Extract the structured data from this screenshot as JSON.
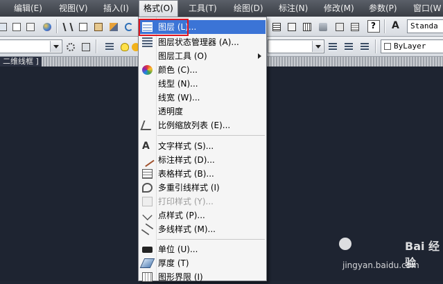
{
  "menubar": {
    "items": [
      "编辑(E)",
      "视图(V)",
      "插入(I)",
      "格式(O)",
      "工具(T)",
      "绘图(D)",
      "标注(N)",
      "修改(M)",
      "参数(P)",
      "窗口(W"
    ],
    "active_index": 3
  },
  "toolbar": {
    "style_combo_value": "Standa",
    "bylayer_combo_value": "ByLayer"
  },
  "viewport": {
    "label": "二维线框 ]"
  },
  "format_menu": {
    "items": [
      {
        "label": "图层 (L)...",
        "icon": "layer-icon",
        "selected": true
      },
      {
        "label": "图层状态管理器 (A)...",
        "icon": "layer-state-manager-icon"
      },
      {
        "label": "图层工具 (O)",
        "icon": "",
        "submenu": true
      },
      {
        "label": "颜色 (C)...",
        "icon": "color-wheel-icon"
      },
      {
        "label": "线型 (N)...",
        "icon": ""
      },
      {
        "label": "线宽 (W)...",
        "icon": ""
      },
      {
        "label": "透明度",
        "icon": ""
      },
      {
        "label": "比例缩放列表 (E)...",
        "icon": "scale-list-icon"
      },
      {
        "label": "文字样式 (S)...",
        "icon": "text-style-icon"
      },
      {
        "label": "标注样式 (D)...",
        "icon": "dimension-style-icon"
      },
      {
        "label": "表格样式 (B)...",
        "icon": "table-style-icon"
      },
      {
        "label": "多重引线样式 (I)",
        "icon": "multileader-style-icon"
      },
      {
        "label": "打印样式 (Y)...",
        "icon": "plot-style-icon",
        "disabled": true
      },
      {
        "label": "点样式 (P)...",
        "icon": "point-style-icon"
      },
      {
        "label": "多线样式 (M)...",
        "icon": "multiline-style-icon"
      },
      {
        "label": "单位 (U)...",
        "icon": "units-icon"
      },
      {
        "label": "厚度 (T)",
        "icon": "thickness-icon"
      },
      {
        "label": "图形界限 (I)",
        "icon": "drawing-limits-icon"
      }
    ]
  },
  "watermark": {
    "brand": "Bai 经验",
    "url": "jingyan.baidu.com"
  },
  "colors": {
    "menubar_bg": "#4a4e56",
    "menu_selected": "#3b74d6",
    "highlight_box": "#e0141e",
    "canvas_bg": "#1e2431"
  }
}
